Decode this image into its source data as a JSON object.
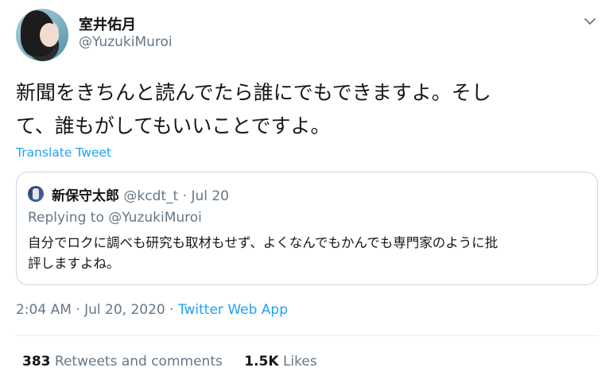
{
  "author": {
    "name": "室井佑月",
    "handle": "@YuzukiMuroi"
  },
  "tweet": {
    "line1": "新聞をきちんと読んでたら誰にでもできますよ。そし",
    "line2": "て、誰もがしてもいいことですよ。",
    "translate_label": "Translate Tweet"
  },
  "quote": {
    "name": "新保守太郎",
    "handle": "@kcdt_t",
    "separator": "·",
    "date": "Jul 20",
    "replying_prefix": "Replying to ",
    "replying_handle": "@YuzukiMuroi",
    "line1": "自分でロクに調べも研究も取材もせず、よくなんでもかんでも専門家のように批",
    "line2": "評しますよね。"
  },
  "meta": {
    "timestamp": "2:04 AM · Jul 20, 2020",
    "separator": "·",
    "source": "Twitter Web App"
  },
  "stats": {
    "retweets_count": "383",
    "retweets_label": "Retweets and comments",
    "likes_count": "1.5K",
    "likes_label": "Likes"
  },
  "icons": {
    "caret": "chevron-down-icon"
  },
  "colors": {
    "link": "#1da1f2",
    "secondary_text": "#657786",
    "primary_text": "#14171a",
    "border": "#ccd6dd"
  }
}
